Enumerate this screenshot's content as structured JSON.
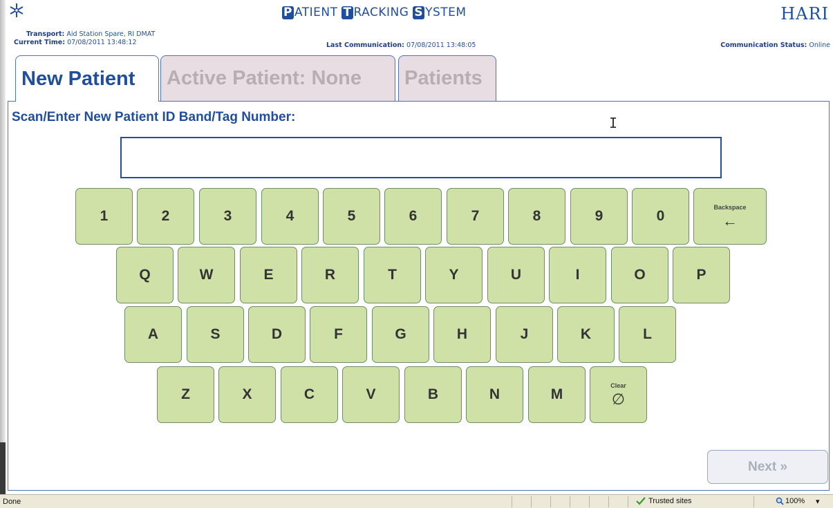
{
  "header": {
    "title_parts": [
      {
        "cap": "P",
        "rest": "ATIENT "
      },
      {
        "cap": "T",
        "rest": "RACKING "
      },
      {
        "cap": "S",
        "rest": "YSTEM"
      }
    ],
    "brand": "HARI",
    "transport_label": "Transport:",
    "transport_value": "Aid Station Spare, RI DMAT",
    "time_label": "Current Time:",
    "time_value": "07/08/2011 13:48:12",
    "lastcomm_label": "Last Communication:",
    "lastcomm_value": "07/08/2011 13:48:05",
    "commstatus_label": "Communication Status:",
    "commstatus_value": "Online"
  },
  "tabs": [
    {
      "label": "New Patient",
      "active": true
    },
    {
      "label": "Active Patient: None",
      "active": false
    },
    {
      "label": "Patients",
      "active": false
    }
  ],
  "form": {
    "prompt": "Scan/Enter New Patient ID Band/Tag Number:",
    "input_value": ""
  },
  "keyboard": {
    "row1": [
      "1",
      "2",
      "3",
      "4",
      "5",
      "6",
      "7",
      "8",
      "9",
      "0"
    ],
    "backspace_label": "Backspace",
    "backspace_symbol": "←",
    "row2": [
      "Q",
      "W",
      "E",
      "R",
      "T",
      "Y",
      "U",
      "I",
      "O",
      "P"
    ],
    "row3": [
      "A",
      "S",
      "D",
      "F",
      "G",
      "H",
      "J",
      "K",
      "L"
    ],
    "row4": [
      "Z",
      "X",
      "C",
      "V",
      "B",
      "N",
      "M"
    ],
    "clear_label": "Clear",
    "clear_symbol": "∅"
  },
  "next_label": "Next »",
  "statusbar": {
    "status": "Done",
    "zone": "Trusted sites",
    "zoom": "100%"
  },
  "colors": {
    "accent": "#1f4e9e",
    "key_fill": "#cfe1a6",
    "inactive_tab": "#e9dde4"
  }
}
